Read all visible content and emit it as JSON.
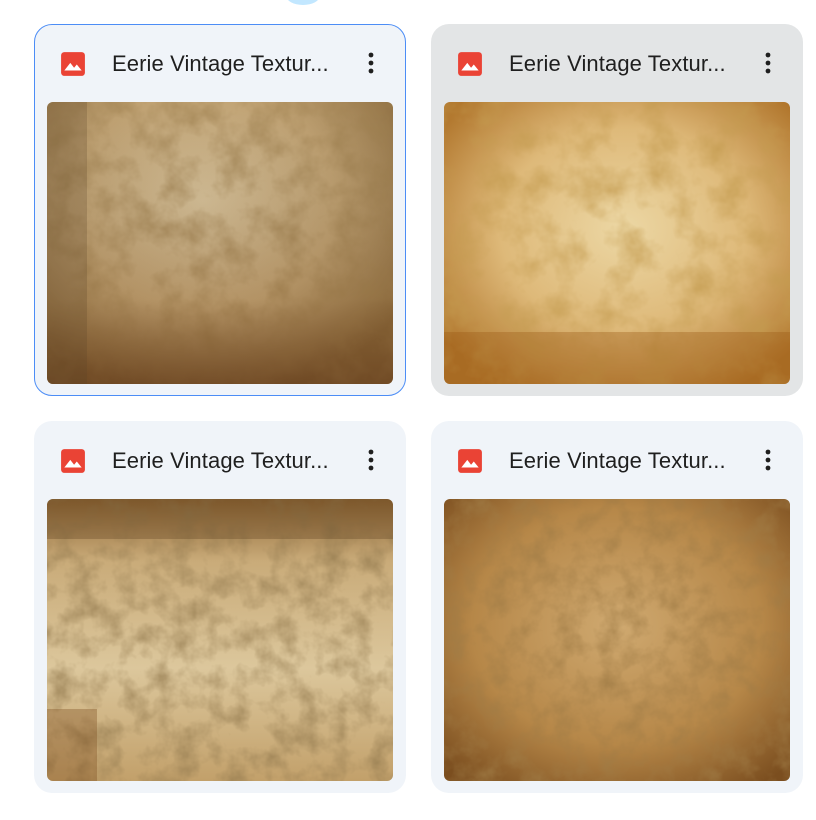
{
  "files": [
    {
      "name": "Eerie Vintage Textur...",
      "type_icon": "image-icon",
      "more_icon": "more-vert-icon",
      "state": "selected"
    },
    {
      "name": "Eerie Vintage Textur...",
      "type_icon": "image-icon",
      "more_icon": "more-vert-icon",
      "state": "hovered"
    },
    {
      "name": "Eerie Vintage Textur...",
      "type_icon": "image-icon",
      "more_icon": "more-vert-icon",
      "state": "normal"
    },
    {
      "name": "Eerie Vintage Textur...",
      "type_icon": "image-icon",
      "more_icon": "more-vert-icon",
      "state": "normal"
    }
  ],
  "colors": {
    "icon_red": "#ea4335",
    "selected_border": "#4c8df6",
    "card_bg": "#f0f4f9",
    "card_hover_bg": "#e3e5e6"
  }
}
